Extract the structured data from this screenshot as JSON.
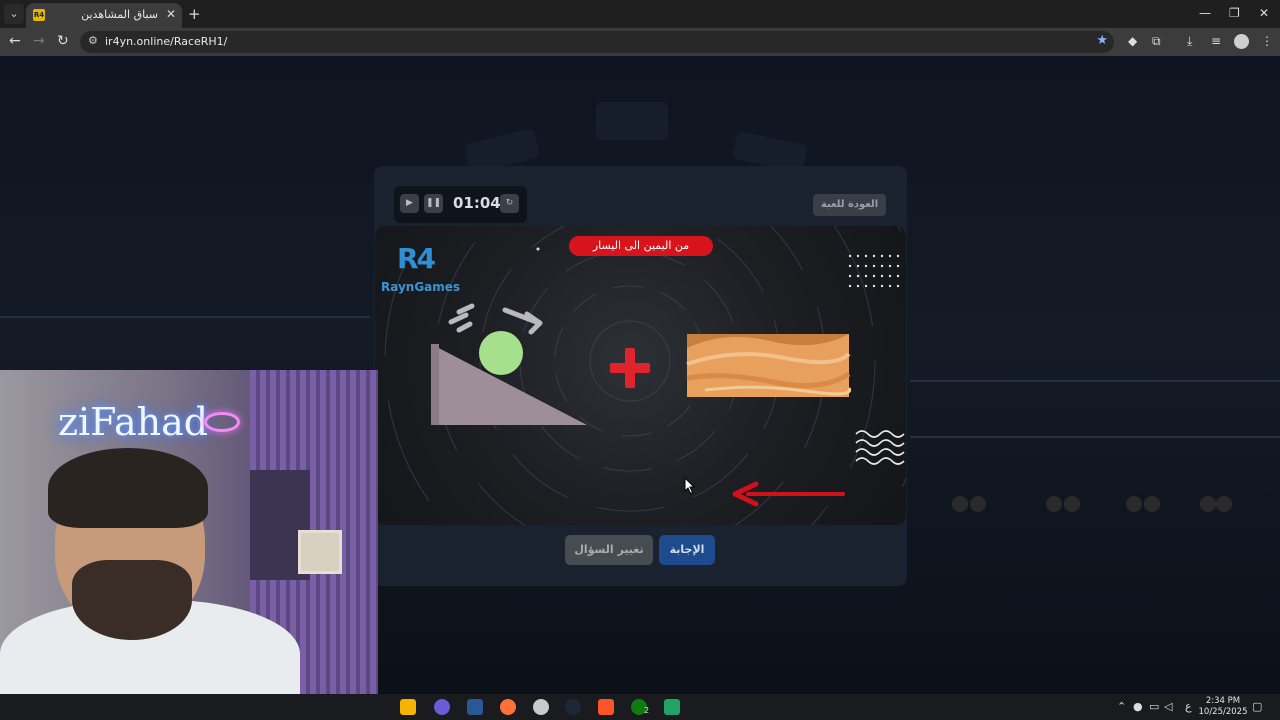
{
  "browser": {
    "tab_title": "سباق المشاهدين",
    "tab_favicon": "R4",
    "url": "ir4yn.online/RaceRH1/"
  },
  "game": {
    "timer": "01:04",
    "back_label": "العودة للعبة",
    "direction_label": "من اليمين الى اليسار",
    "logo_mark": "R4",
    "logo_name": "RaynGames",
    "answer_label": "الإجابة",
    "change_label": "تغيير السؤال",
    "icons": [
      "play-icon",
      "pause-icon",
      "refresh-icon",
      "ramp-ball-icon",
      "plus-icon",
      "sand-dune-icon",
      "left-arrow-icon"
    ],
    "colors": {
      "pill": "#d7141b",
      "plus": "#e1242c",
      "ball": "#a6e08d",
      "ramp": "#9e8e99",
      "answer": "#1e4a8e"
    }
  },
  "stream": {
    "neon_text": "ziFahad"
  },
  "taskbar": {
    "time": "2:34 PM",
    "date": "10/25/2025",
    "lang": "ع",
    "badge": "2"
  }
}
